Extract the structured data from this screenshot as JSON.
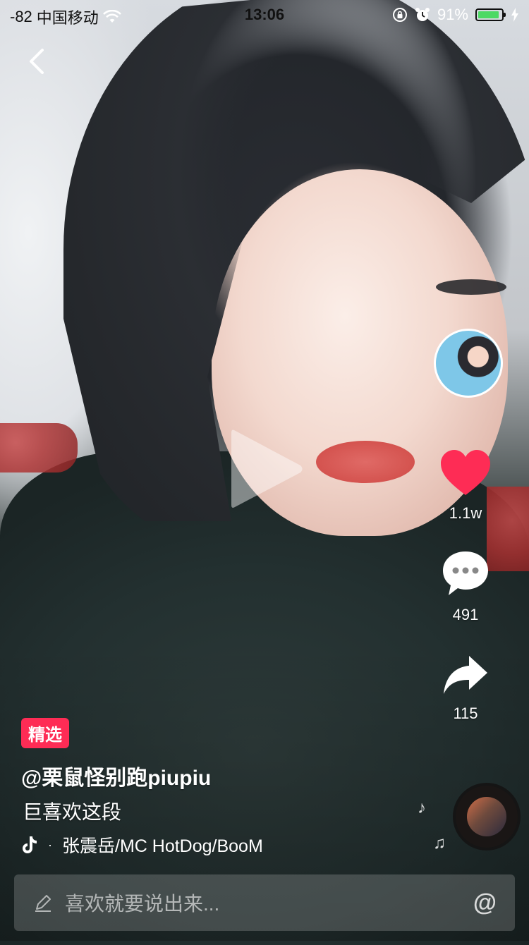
{
  "status_bar": {
    "signal": "-82",
    "carrier": "中国移动",
    "time": "13:06",
    "battery_percent": "91%",
    "battery_level": 0.91
  },
  "video": {
    "badge": "精选",
    "author": "@栗鼠怪别跑piupiu",
    "caption": "巨喜欢这段",
    "music": "张震岳/MC HotDog/BooM"
  },
  "actions": {
    "likes": "1.1w",
    "comments": "491",
    "shares": "115"
  },
  "comment_input": {
    "placeholder": "喜欢就要说出来..."
  },
  "colors": {
    "like": "#fe2c55",
    "badge": "#fe2c55",
    "battery": "#4cd964"
  }
}
